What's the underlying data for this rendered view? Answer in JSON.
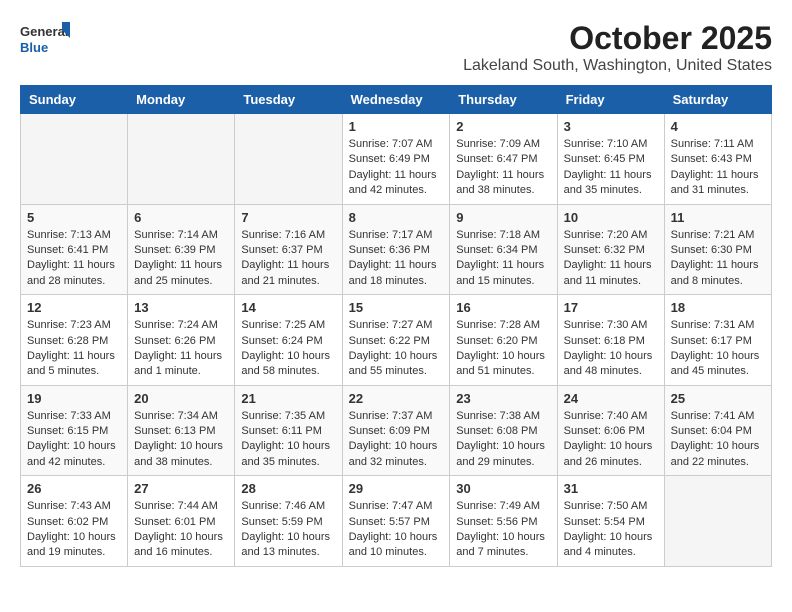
{
  "header": {
    "logo_general": "General",
    "logo_blue": "Blue",
    "month": "October 2025",
    "location": "Lakeland South, Washington, United States"
  },
  "weekdays": [
    "Sunday",
    "Monday",
    "Tuesday",
    "Wednesday",
    "Thursday",
    "Friday",
    "Saturday"
  ],
  "weeks": [
    [
      {
        "day": "",
        "empty": true
      },
      {
        "day": "",
        "empty": true
      },
      {
        "day": "",
        "empty": true
      },
      {
        "day": "1",
        "sunrise": "7:07 AM",
        "sunset": "6:49 PM",
        "daylight": "11 hours and 42 minutes."
      },
      {
        "day": "2",
        "sunrise": "7:09 AM",
        "sunset": "6:47 PM",
        "daylight": "11 hours and 38 minutes."
      },
      {
        "day": "3",
        "sunrise": "7:10 AM",
        "sunset": "6:45 PM",
        "daylight": "11 hours and 35 minutes."
      },
      {
        "day": "4",
        "sunrise": "7:11 AM",
        "sunset": "6:43 PM",
        "daylight": "11 hours and 31 minutes."
      }
    ],
    [
      {
        "day": "5",
        "sunrise": "7:13 AM",
        "sunset": "6:41 PM",
        "daylight": "11 hours and 28 minutes."
      },
      {
        "day": "6",
        "sunrise": "7:14 AM",
        "sunset": "6:39 PM",
        "daylight": "11 hours and 25 minutes."
      },
      {
        "day": "7",
        "sunrise": "7:16 AM",
        "sunset": "6:37 PM",
        "daylight": "11 hours and 21 minutes."
      },
      {
        "day": "8",
        "sunrise": "7:17 AM",
        "sunset": "6:36 PM",
        "daylight": "11 hours and 18 minutes."
      },
      {
        "day": "9",
        "sunrise": "7:18 AM",
        "sunset": "6:34 PM",
        "daylight": "11 hours and 15 minutes."
      },
      {
        "day": "10",
        "sunrise": "7:20 AM",
        "sunset": "6:32 PM",
        "daylight": "11 hours and 11 minutes."
      },
      {
        "day": "11",
        "sunrise": "7:21 AM",
        "sunset": "6:30 PM",
        "daylight": "11 hours and 8 minutes."
      }
    ],
    [
      {
        "day": "12",
        "sunrise": "7:23 AM",
        "sunset": "6:28 PM",
        "daylight": "11 hours and 5 minutes."
      },
      {
        "day": "13",
        "sunrise": "7:24 AM",
        "sunset": "6:26 PM",
        "daylight": "11 hours and 1 minute."
      },
      {
        "day": "14",
        "sunrise": "7:25 AM",
        "sunset": "6:24 PM",
        "daylight": "10 hours and 58 minutes."
      },
      {
        "day": "15",
        "sunrise": "7:27 AM",
        "sunset": "6:22 PM",
        "daylight": "10 hours and 55 minutes."
      },
      {
        "day": "16",
        "sunrise": "7:28 AM",
        "sunset": "6:20 PM",
        "daylight": "10 hours and 51 minutes."
      },
      {
        "day": "17",
        "sunrise": "7:30 AM",
        "sunset": "6:18 PM",
        "daylight": "10 hours and 48 minutes."
      },
      {
        "day": "18",
        "sunrise": "7:31 AM",
        "sunset": "6:17 PM",
        "daylight": "10 hours and 45 minutes."
      }
    ],
    [
      {
        "day": "19",
        "sunrise": "7:33 AM",
        "sunset": "6:15 PM",
        "daylight": "10 hours and 42 minutes."
      },
      {
        "day": "20",
        "sunrise": "7:34 AM",
        "sunset": "6:13 PM",
        "daylight": "10 hours and 38 minutes."
      },
      {
        "day": "21",
        "sunrise": "7:35 AM",
        "sunset": "6:11 PM",
        "daylight": "10 hours and 35 minutes."
      },
      {
        "day": "22",
        "sunrise": "7:37 AM",
        "sunset": "6:09 PM",
        "daylight": "10 hours and 32 minutes."
      },
      {
        "day": "23",
        "sunrise": "7:38 AM",
        "sunset": "6:08 PM",
        "daylight": "10 hours and 29 minutes."
      },
      {
        "day": "24",
        "sunrise": "7:40 AM",
        "sunset": "6:06 PM",
        "daylight": "10 hours and 26 minutes."
      },
      {
        "day": "25",
        "sunrise": "7:41 AM",
        "sunset": "6:04 PM",
        "daylight": "10 hours and 22 minutes."
      }
    ],
    [
      {
        "day": "26",
        "sunrise": "7:43 AM",
        "sunset": "6:02 PM",
        "daylight": "10 hours and 19 minutes."
      },
      {
        "day": "27",
        "sunrise": "7:44 AM",
        "sunset": "6:01 PM",
        "daylight": "10 hours and 16 minutes."
      },
      {
        "day": "28",
        "sunrise": "7:46 AM",
        "sunset": "5:59 PM",
        "daylight": "10 hours and 13 minutes."
      },
      {
        "day": "29",
        "sunrise": "7:47 AM",
        "sunset": "5:57 PM",
        "daylight": "10 hours and 10 minutes."
      },
      {
        "day": "30",
        "sunrise": "7:49 AM",
        "sunset": "5:56 PM",
        "daylight": "10 hours and 7 minutes."
      },
      {
        "day": "31",
        "sunrise": "7:50 AM",
        "sunset": "5:54 PM",
        "daylight": "10 hours and 4 minutes."
      },
      {
        "day": "",
        "empty": true
      }
    ]
  ]
}
